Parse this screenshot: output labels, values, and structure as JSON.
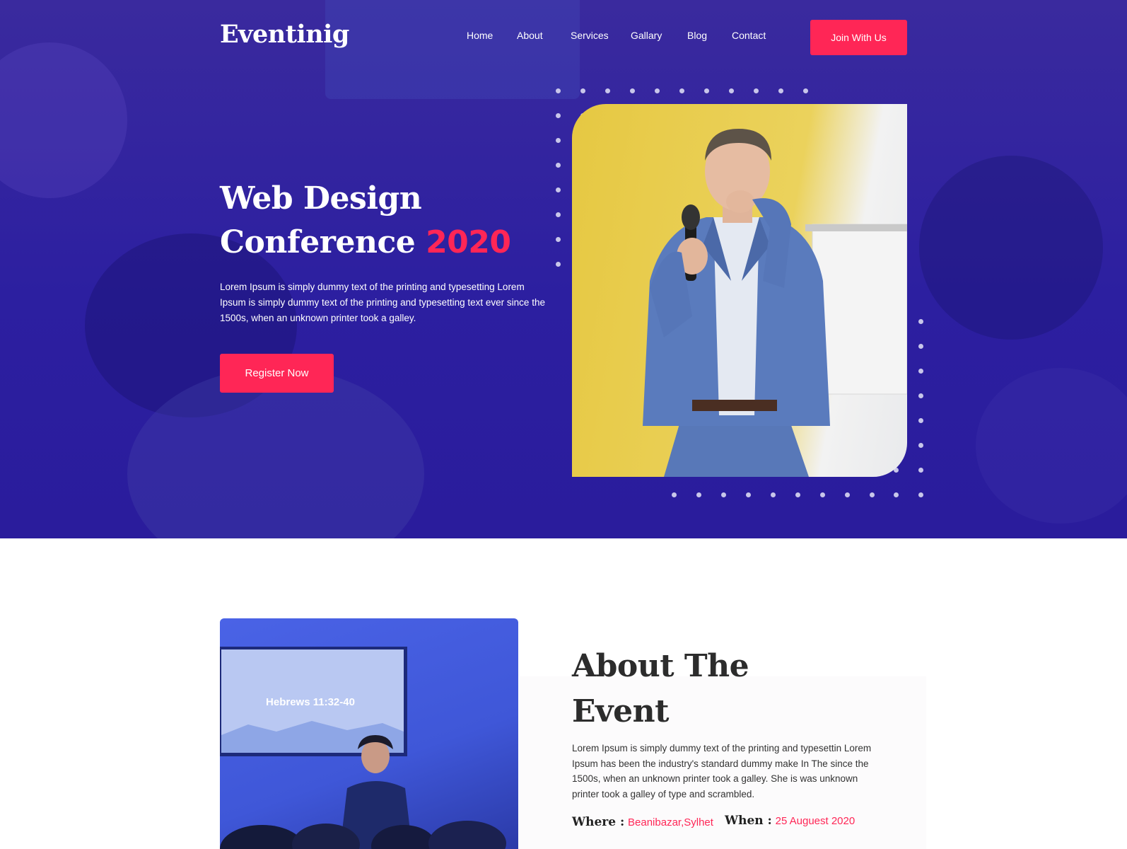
{
  "header": {
    "logo": "Eventinig",
    "nav": [
      "Home",
      "About",
      "Services",
      "Gallary",
      "Blog",
      "Contact"
    ],
    "cta": "Join With Us"
  },
  "hero": {
    "title_line1": "Web Design",
    "title_line2": "Conference",
    "title_accent": "2020",
    "description": "Lorem Ipsum is simply dummy text of the printing and typesetting Lorem Ipsum is simply dummy text of the printing and typesetting text ever since the 1500s, when an unknown printer took a galley.",
    "register_label": "Register Now"
  },
  "about": {
    "title_line1": "About The",
    "title_line2": "Event",
    "description": "Lorem Ipsum is simply dummy text of the printing and typesettin Lorem Ipsum has been the industry's standard dummy make In The since the 1500s, when an unknown printer took a galley. She is was unknown printer took a galley of type and scrambled.",
    "screen_text": "Hebrews 11:32-40",
    "where_label": "Where :",
    "where_value": "Beanibazar,Sylhet",
    "when_label": "When :",
    "when_value": "25 Auguest 2020"
  },
  "colors": {
    "hero_bg": "#2c1fa0",
    "accent": "#ff2656",
    "dots": "#c8c6ea"
  }
}
